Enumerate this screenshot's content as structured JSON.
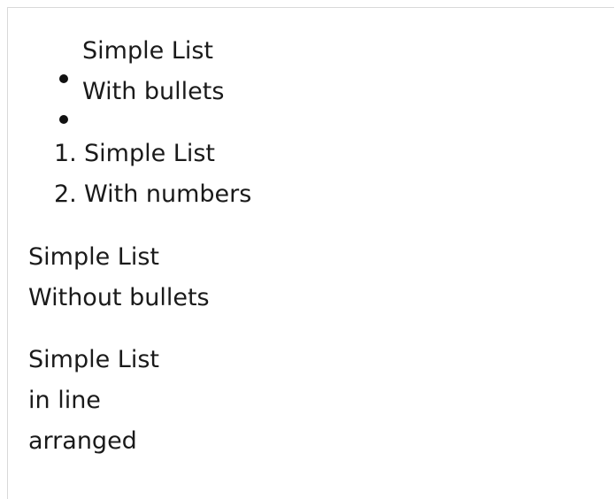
{
  "bullet_list": {
    "items": [
      "Simple List",
      "With bullets"
    ]
  },
  "numbered_list": {
    "markers": [
      "1.",
      "2."
    ],
    "items": [
      "Simple List",
      "With numbers"
    ]
  },
  "plain_list": {
    "items": [
      "Simple List",
      "Without bullets"
    ]
  },
  "inline_list": {
    "items": [
      "Simple List",
      "in line",
      "arranged"
    ]
  },
  "colors": {
    "text": "#1a1a1a",
    "background": "#ffffff",
    "border": "#d9d9d9"
  }
}
